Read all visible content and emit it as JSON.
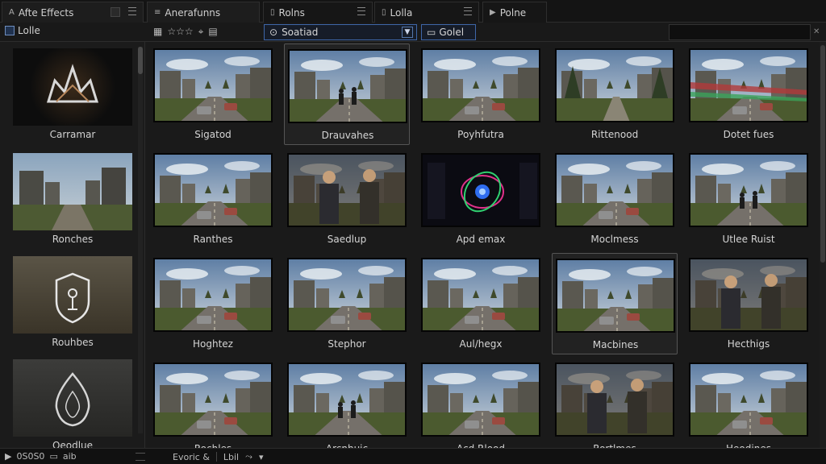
{
  "tabs": [
    {
      "label": "Afte Effects",
      "active": true
    },
    {
      "label": "Anerafunns",
      "active": true
    },
    {
      "label": "Rolns",
      "active": false
    },
    {
      "label": "Lolla",
      "active": false
    },
    {
      "label": "Polne",
      "active": false
    }
  ],
  "toolbar": {
    "left_label": "Lolle",
    "filter_value": "Soatiad",
    "clear_label": "Golel",
    "search_placeholder": ""
  },
  "left_panel": {
    "items": [
      {
        "label": "Carramar",
        "icon": "crown-icon"
      },
      {
        "label": "Ronches",
        "icon": "none"
      },
      {
        "label": "Rouhbes",
        "icon": "shield-icon"
      },
      {
        "label": "Oeodlue",
        "icon": "drop-icon"
      }
    ]
  },
  "grid": {
    "rows": [
      [
        {
          "label": "Sigatod",
          "scene": "road"
        },
        {
          "label": "Drauvahes",
          "scene": "figures"
        },
        {
          "label": "Poyhfutra",
          "scene": "road"
        },
        {
          "label": "Rittenood",
          "scene": "path"
        },
        {
          "label": "Dotet fues",
          "scene": "redroad"
        }
      ],
      [
        {
          "label": "Ranthes",
          "scene": "road"
        },
        {
          "label": "Saedlup",
          "scene": "people"
        },
        {
          "label": "Apd emax",
          "scene": "glow"
        },
        {
          "label": "Moclmess",
          "scene": "road"
        },
        {
          "label": "Utlee Ruist",
          "scene": "figures"
        }
      ],
      [
        {
          "label": "Hoghtez",
          "scene": "road"
        },
        {
          "label": "Stephor",
          "scene": "road"
        },
        {
          "label": "Aul/hegx",
          "scene": "road"
        },
        {
          "label": "Macbines",
          "scene": "road"
        },
        {
          "label": "Hecthigs",
          "scene": "people"
        }
      ],
      [
        {
          "label": "Rochles",
          "scene": "road"
        },
        {
          "label": "Arcnhuic",
          "scene": "figures"
        },
        {
          "label": "Acd Rlood",
          "scene": "road"
        },
        {
          "label": "Rortlmes",
          "scene": "people"
        },
        {
          "label": "Heodines",
          "scene": "road"
        }
      ]
    ]
  },
  "status": {
    "counter": "0S0S0",
    "small_label": "aib",
    "event_label": "Evoric &",
    "lut_label": "Lbil"
  }
}
